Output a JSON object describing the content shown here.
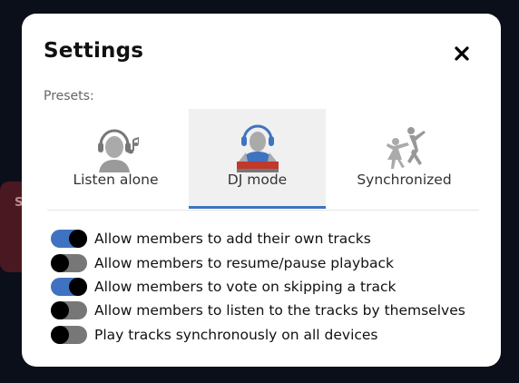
{
  "background": {
    "card_letter": "S"
  },
  "modal": {
    "title": "Settings",
    "close_icon": "close-icon",
    "presets_label": "Presets:",
    "presets": [
      {
        "label": "Listen alone",
        "icon": "headphones-person-icon",
        "active": false
      },
      {
        "label": "DJ mode",
        "icon": "dj-icon",
        "active": true
      },
      {
        "label": "Synchronized",
        "icon": "dancing-couple-icon",
        "active": false
      }
    ],
    "options": [
      {
        "label": "Allow members to add their own tracks",
        "enabled": true
      },
      {
        "label": "Allow members to resume/pause playback",
        "enabled": false
      },
      {
        "label": "Allow members to vote on skipping a track",
        "enabled": true
      },
      {
        "label": "Allow members to listen to the tracks by themselves",
        "enabled": false
      },
      {
        "label": "Play tracks synchronously on all devices",
        "enabled": false
      }
    ]
  },
  "colors": {
    "accent": "#3f73c1",
    "toggle_off": "#777777",
    "page_bg": "#0b0f19",
    "dj_deck": "#c0392b"
  }
}
